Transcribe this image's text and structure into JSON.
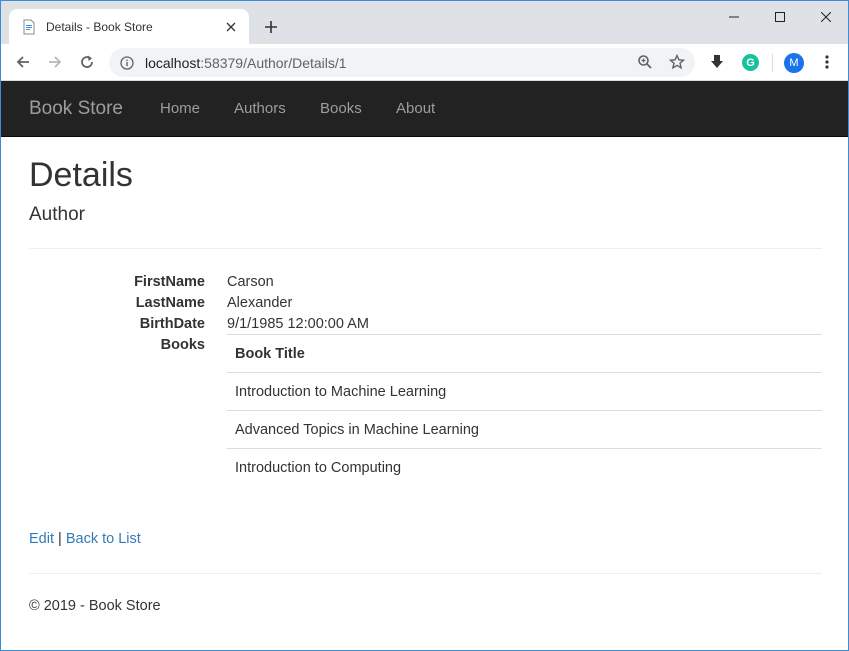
{
  "browser": {
    "tab_title": "Details - Book Store",
    "url_host": "localhost",
    "url_rest": ":58379/Author/Details/1",
    "avatar_initial": "M",
    "grammarly_letter": "G"
  },
  "navbar": {
    "brand": "Book Store",
    "links": [
      "Home",
      "Authors",
      "Books",
      "About"
    ]
  },
  "page": {
    "title": "Details",
    "subtitle": "Author"
  },
  "details": {
    "firstname_label": "FirstName",
    "firstname_value": "Carson",
    "lastname_label": "LastName",
    "lastname_value": "Alexander",
    "birthdate_label": "BirthDate",
    "birthdate_value": "9/1/1985 12:00:00 AM",
    "books_label": "Books"
  },
  "books_table": {
    "header": "Book Title",
    "rows": [
      "Introduction to Machine Learning",
      "Advanced Topics in Machine Learning",
      "Introduction to Computing"
    ]
  },
  "actions": {
    "edit": "Edit",
    "separator": "|",
    "back": "Back to List"
  },
  "footer": {
    "text": "© 2019 - Book Store"
  },
  "colors": {
    "navbar_bg": "#222222",
    "nav_text": "#9d9d9d",
    "link": "#337ab7",
    "window_border": "#3c8cd6"
  }
}
